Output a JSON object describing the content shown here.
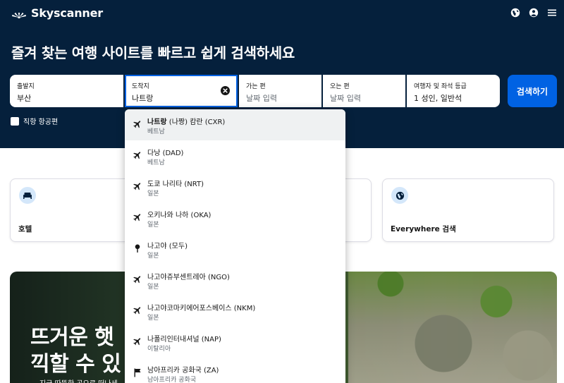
{
  "header": {
    "logo_text": "Skyscanner",
    "icons": [
      "globe-icon",
      "account-icon",
      "menu-icon"
    ]
  },
  "hero": {
    "headline": "즐겨 찾는 여행 사이트를 빠르고 쉽게 검색하세요"
  },
  "search_form": {
    "origin": {
      "label": "출발지",
      "value": "부산"
    },
    "destination": {
      "label": "도착지",
      "value": "나트랑"
    },
    "depart": {
      "label": "가는 편",
      "placeholder": "날짜 입력"
    },
    "return": {
      "label": "오는 편",
      "placeholder": "날짜 입력"
    },
    "travellers": {
      "label": "여행자 및 좌석 등급",
      "value": "1 성인, 일반석"
    },
    "search_label": "검색하기",
    "direct_flights_label": "직항 항공편",
    "direct_flights_checked": false
  },
  "cards": [
    {
      "label": "호텔",
      "icon": "bed-icon"
    },
    {
      "label": "",
      "icon": ""
    },
    {
      "label": "Everywhere 검색",
      "icon": "globe-icon"
    }
  ],
  "banner": {
    "title_line1": "뜨거운 햇",
    "title_line2": "끽할 수 있",
    "subtitle": "지금 따뜻한 곳으로 떠나세"
  },
  "suggestions": [
    {
      "name": "나트랑",
      "detail": " (나짱) 캄란 (CXR)",
      "country": "베트남",
      "icon": "airplane-icon",
      "highlighted": true
    },
    {
      "name": "다낭 (DAD)",
      "country": "베트남",
      "icon": "airplane-icon"
    },
    {
      "name": "도쿄 나리타 (NRT)",
      "country": "일본",
      "icon": "airplane-icon"
    },
    {
      "name": "오키나와 나하 (OKA)",
      "country": "일본",
      "icon": "airplane-icon"
    },
    {
      "name": "나고야 (모두)",
      "country": "일본",
      "icon": "location-pin-icon"
    },
    {
      "name": "나고야쥬부센트레아 (NGO)",
      "country": "일본",
      "icon": "airplane-icon"
    },
    {
      "name": "나고야코마키에어포스베이스 (NKM)",
      "country": "일본",
      "icon": "airplane-icon"
    },
    {
      "name": "나폴리인터내셔널 (NAP)",
      "country": "이탈리아",
      "icon": "airplane-icon"
    },
    {
      "name": "남아프리카 공화국 (ZA)",
      "country": "남아프리카 공화국",
      "icon": "flag-icon"
    }
  ],
  "colors": {
    "hero_bg": "#05203c",
    "accent": "#0062e3",
    "muted_text": "#626971"
  }
}
